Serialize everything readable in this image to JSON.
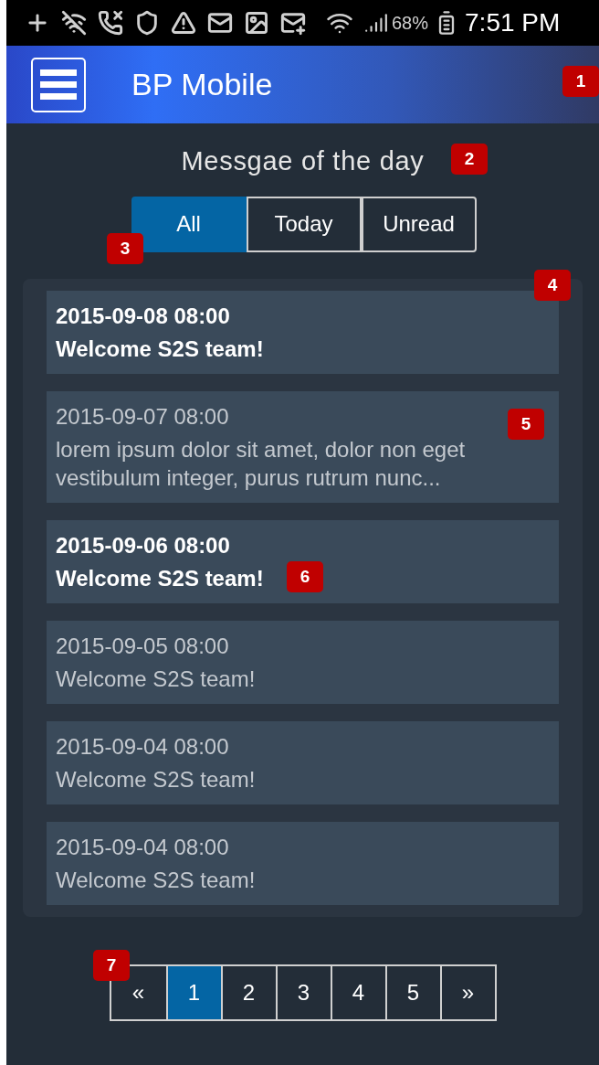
{
  "status_bar": {
    "battery": "68%",
    "time": "7:51 PM"
  },
  "app_bar": {
    "title": "BP Mobile"
  },
  "heading": "Messgae of the day",
  "tabs": [
    {
      "label": "All",
      "selected": true
    },
    {
      "label": "Today",
      "selected": false
    },
    {
      "label": "Unread",
      "selected": false
    }
  ],
  "messages": [
    {
      "date": "2015-09-08 08:00",
      "text": "Welcome S2S team!",
      "unread": true
    },
    {
      "date": "2015-09-07 08:00",
      "text": "lorem ipsum dolor sit amet, dolor non eget vestibulum integer, purus rutrum nunc...",
      "unread": false
    },
    {
      "date": "2015-09-06 08:00",
      "text": "Welcome S2S team!",
      "unread": true
    },
    {
      "date": "2015-09-05 08:00",
      "text": "Welcome S2S team!",
      "unread": false
    },
    {
      "date": "2015-09-04 08:00",
      "text": "Welcome S2S team!",
      "unread": false
    },
    {
      "date": "2015-09-04 08:00",
      "text": "Welcome S2S team!",
      "unread": false
    }
  ],
  "pagination": [
    {
      "label": "«",
      "selected": false
    },
    {
      "label": "1",
      "selected": true
    },
    {
      "label": "2",
      "selected": false
    },
    {
      "label": "3",
      "selected": false
    },
    {
      "label": "4",
      "selected": false
    },
    {
      "label": "5",
      "selected": false
    },
    {
      "label": "»",
      "selected": false
    }
  ],
  "callouts": [
    "1",
    "2",
    "3",
    "4",
    "5",
    "6",
    "7"
  ]
}
